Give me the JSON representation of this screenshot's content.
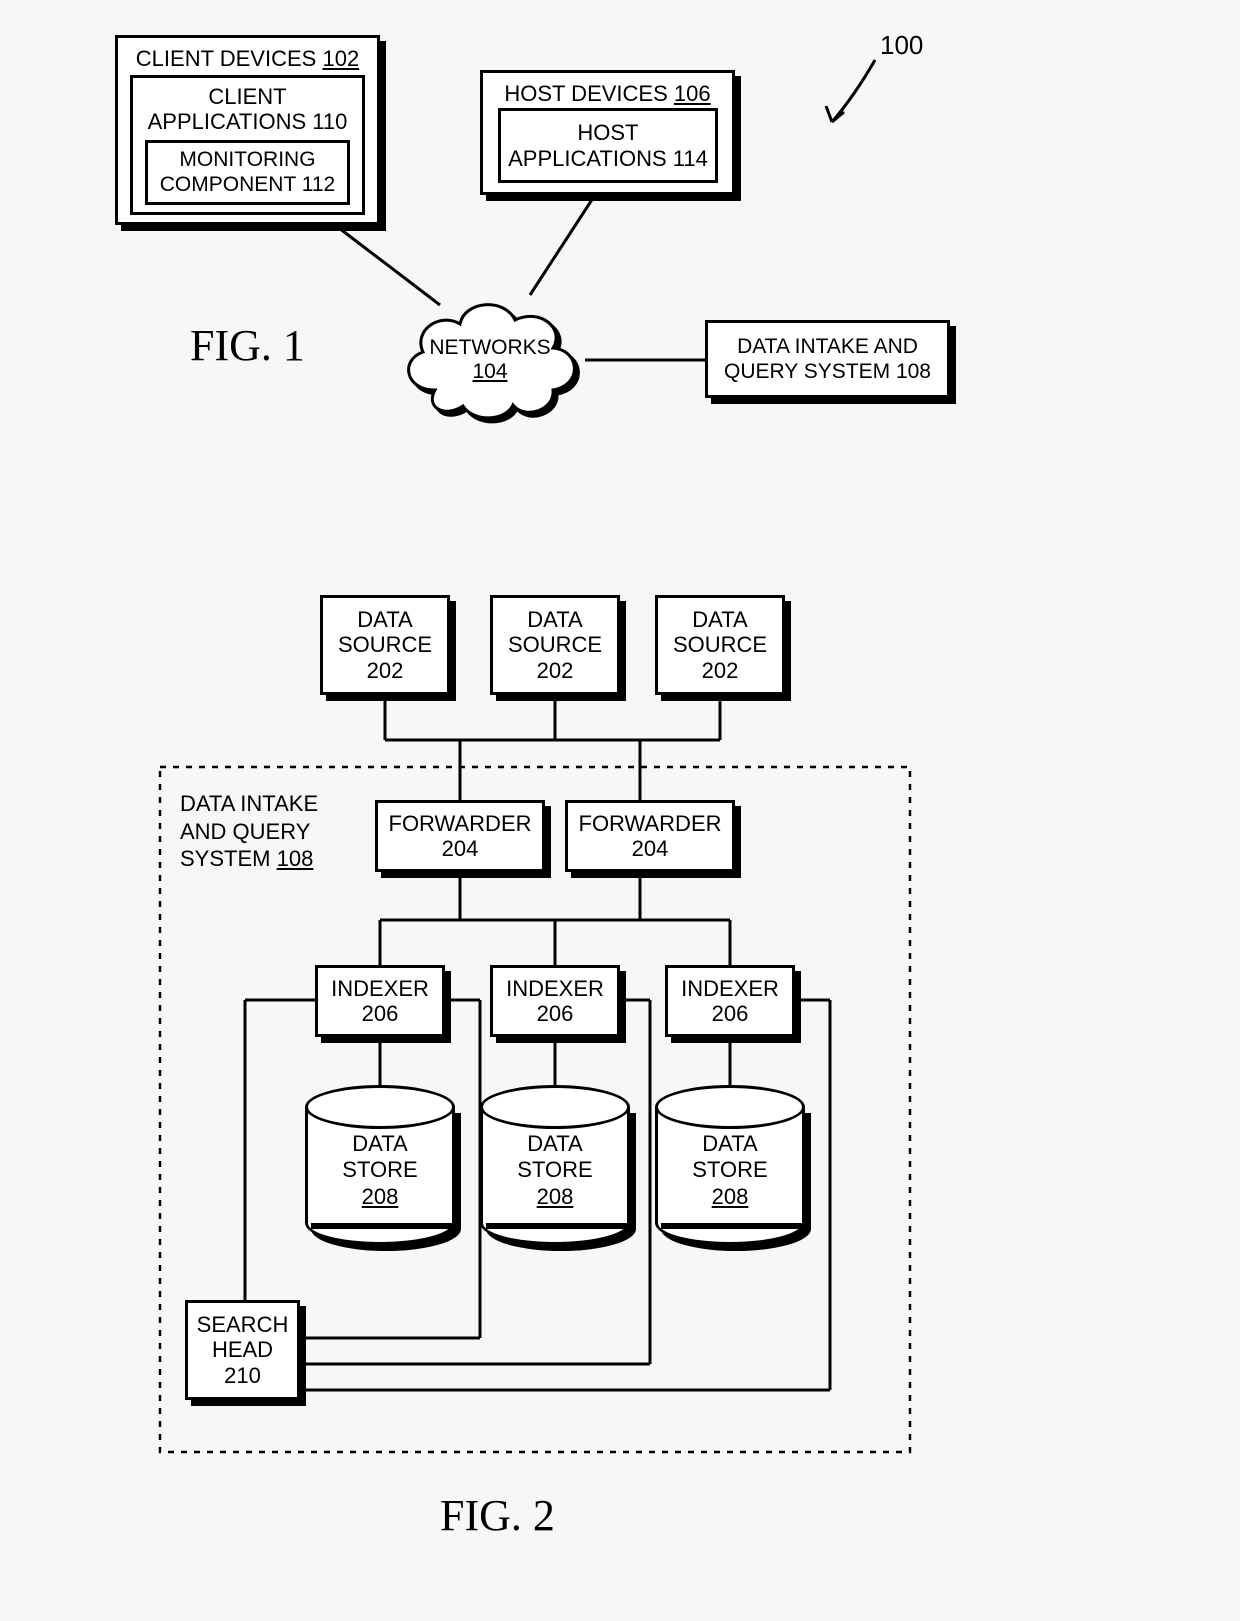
{
  "figures": {
    "fig1": {
      "caption": "FIG. 1",
      "ref": "100",
      "client_devices": {
        "label": "CLIENT DEVICES",
        "ref": "102"
      },
      "client_apps": {
        "label1": "CLIENT",
        "label2": "APPLICATIONS",
        "ref": "110"
      },
      "monitoring": {
        "label1": "MONITORING",
        "label2": "COMPONENT",
        "ref": "112"
      },
      "host_devices": {
        "label": "HOST DEVICES",
        "ref": "106"
      },
      "host_apps": {
        "label1": "HOST",
        "label2": "APPLICATIONS",
        "ref": "114"
      },
      "networks": {
        "label": "NETWORKS",
        "ref": "104"
      },
      "data_intake": {
        "label1": "DATA INTAKE AND",
        "label2": "QUERY SYSTEM",
        "ref": "108"
      }
    },
    "fig2": {
      "caption": "FIG. 2",
      "system_label": {
        "line1": "DATA INTAKE",
        "line2": "AND QUERY",
        "line3": "SYSTEM",
        "ref": "108"
      },
      "data_source": {
        "label1": "DATA",
        "label2": "SOURCE",
        "ref": "202"
      },
      "forwarder": {
        "label": "FORWARDER",
        "ref": "204"
      },
      "indexer": {
        "label": "INDEXER",
        "ref": "206"
      },
      "data_store": {
        "label1": "DATA",
        "label2": "STORE",
        "ref": "208"
      },
      "search_head": {
        "label1": "SEARCH",
        "label2": "HEAD",
        "ref": "210"
      }
    }
  }
}
